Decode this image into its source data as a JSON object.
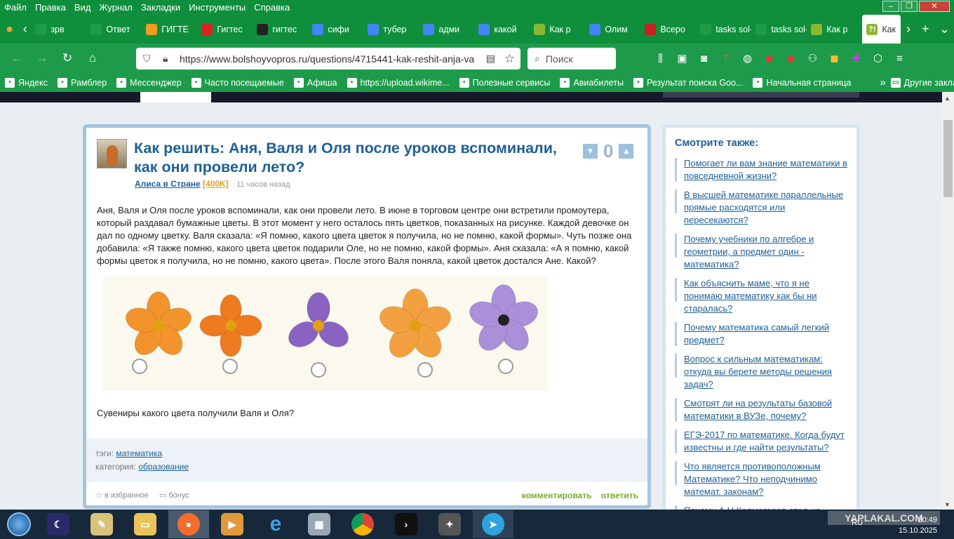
{
  "menu": [
    "Файл",
    "Правка",
    "Вид",
    "Журнал",
    "Закладки",
    "Инструменты",
    "Справка"
  ],
  "tabs": [
    {
      "label": "зрв",
      "icon_color": "#1e9b4a"
    },
    {
      "label": "Ответ",
      "icon_color": "#1e9b4a"
    },
    {
      "label": "ГИГТЕ",
      "icon_color": "#f39b1e"
    },
    {
      "label": "Гигтес",
      "icon_color": "#d22"
    },
    {
      "label": "гигтес",
      "icon_color": "#222"
    },
    {
      "label": "сифи",
      "icon_color": "#4285f4"
    },
    {
      "label": "тубер",
      "icon_color": "#4285f4"
    },
    {
      "label": "адми",
      "icon_color": "#4285f4"
    },
    {
      "label": "какой",
      "icon_color": "#4285f4"
    },
    {
      "label": "Как р",
      "icon_color": "#8ab832"
    },
    {
      "label": "Олим",
      "icon_color": "#4285f4"
    },
    {
      "label": "Всеро",
      "icon_color": "#cc1f1f"
    },
    {
      "label": "tasks sol-r",
      "icon_color": "#1e9b4a"
    },
    {
      "label": "tasks sol-r",
      "icon_color": "#1e9b4a"
    },
    {
      "label": "Как р",
      "icon_color": "#8ab832"
    }
  ],
  "active_tab": {
    "label": "Как",
    "icon_color": "#8ab832"
  },
  "url": "https://www.bolshoyvopros.ru/questions/4715441-kak-reshit-anja-va",
  "search_placeholder": "Поиск",
  "bookmarks": [
    "Яндекс",
    "Рамблер",
    "Мессенджер",
    "Часто посещаемые",
    "Афиша",
    "https://upload.wikime...",
    "Полезные сервисы",
    "Авиабилеты",
    "Результат поиска Goo...",
    "Начальная страница"
  ],
  "other_bookmarks": "Другие закладки",
  "question": {
    "title": "Как решить: Аня, Валя и Оля после уроков вспоминали, как они провели лето?",
    "author": "Алиса в Стране",
    "rank": "[400K]",
    "time": "11 часов назад",
    "votes": "0",
    "text": "Аня, Валя и Оля после уроков вспоминали, как они провели лето. В июне в торговом центре они встретили промоутера, который раздавал бумажные цветы. В этот момент у него осталось пять цветков, показанных на рисунке. Каждой девочке он дал по одному цветку. Валя сказала: «Я помню, какого цвета цветок я получила, но не помню, какой формы». Чуть позже она добавила: «Я также помню, какого цвета цветок подарили Оле, но не помню, какой формы». Аня сказала: «А я помню, какой формы цветок я получила, но не помню, какого цвета». После этого Валя поняла, какой цветок достался Ане. Какой?",
    "question2": "Сувениры какого цвета получили Валя и Оля?",
    "tags_label": "тэги:",
    "tag": "математика",
    "category_label": "категория:",
    "category": "образование",
    "fav": "в избранное",
    "bonus": "бонус",
    "comment": "комментировать",
    "answer": "ответить"
  },
  "flowers": [
    {
      "name": "orange-5",
      "color": "#f2932c",
      "petals": 5
    },
    {
      "name": "orange-4",
      "color": "#ee7a22",
      "petals": 4
    },
    {
      "name": "purple-3",
      "color": "#8a63c2",
      "petals": 3
    },
    {
      "name": "orange-star",
      "color": "#f3a040",
      "petals": 5
    },
    {
      "name": "lilac-5",
      "color": "#a990d8",
      "petals": 5
    }
  ],
  "sidebar": {
    "title": "Смотрите также:",
    "items": [
      "Помогает ли вам знание математики в повседневной жизни?",
      "В высшей математике параллельные прямые расходятся или пересекаются?",
      "Почему учебники по алгебре и геометрии, а предмет один - математика?",
      "Как объяснить маме, что я не понимаю математику как бы ни старалась?",
      "Почему математика самый легкий предмет?",
      "Вопрос к сильным математикам: откуда вы берете методы решения задач?",
      "Смотрят ли на результаты базовой математики в ВУЗе, почему?",
      "ЕГЭ-2017 по математике. Когда будут известны и где найти результаты?",
      "Что является противоположным Математике? Что неподчинимо математ. законам?",
      "Почему А.Н.Колмогоров стал не"
    ]
  },
  "taskbar": {
    "lang": "RU",
    "time": "20:49",
    "date": "15.10.2025",
    "watermark": "YAPLAKAL.COM"
  }
}
